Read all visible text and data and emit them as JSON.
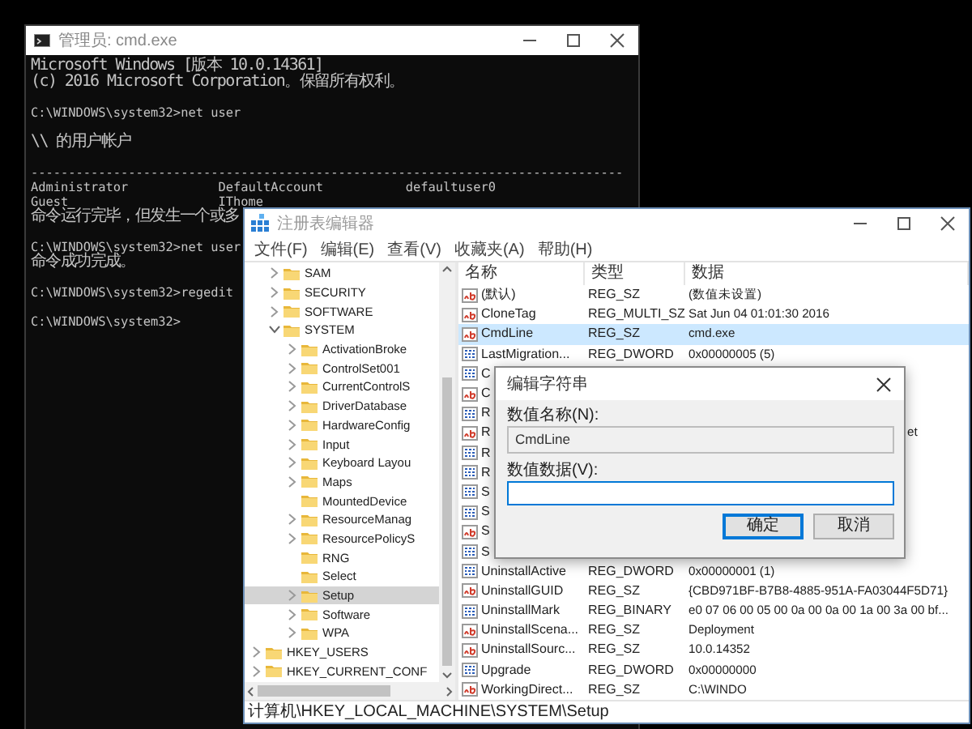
{
  "console_window": {
    "title": "管理员: cmd.exe",
    "blocks": [
      [
        "Microsoft Windows [版本 10.0.14361]",
        "(c) 2016 Microsoft Corporation。保留所有权利。"
      ],
      [
        "C:\\WINDOWS\\system32>net user"
      ],
      [
        "\\\\ 的用户帐户"
      ],
      [
        "-------------------------------------------------------------------------------",
        "Administrator            DefaultAccount           defaultuser0",
        "Guest                    IThome",
        "命令运行完毕，但发生一个或多"
      ],
      [
        "C:\\WINDOWS\\system32>net user",
        "命令成功完成。"
      ],
      [
        "C:\\WINDOWS\\system32>regedit"
      ],
      [
        "C:\\WINDOWS\\system32>"
      ]
    ]
  },
  "regedit_window": {
    "title": "注册表编辑器",
    "menu": [
      "文件(F)",
      "编辑(E)",
      "查看(V)",
      "收藏夹(A)",
      "帮助(H)"
    ],
    "tree": [
      {
        "children": [
          {
            "label": "SAM",
            "kind": "branch",
            "expanded": false,
            "selected": false
          },
          {
            "label": "SECURITY",
            "kind": "branch",
            "expanded": false,
            "selected": false
          },
          {
            "label": "SOFTWARE",
            "kind": "branch",
            "expanded": false,
            "selected": false
          },
          {
            "label": "SYSTEM",
            "kind": "branch",
            "expanded": true,
            "selected": false,
            "children": [
              {
                "label": "ActivationBroke",
                "kind": "branch",
                "expanded": false,
                "selected": false
              },
              {
                "label": "ControlSet001",
                "kind": "branch",
                "expanded": false,
                "selected": false
              },
              {
                "label": "CurrentControlS",
                "kind": "branch",
                "expanded": false,
                "selected": false
              },
              {
                "label": "DriverDatabase",
                "kind": "branch",
                "expanded": false,
                "selected": false
              },
              {
                "label": "HardwareConfig",
                "kind": "branch",
                "expanded": false,
                "selected": false
              },
              {
                "label": "Input",
                "kind": "branch",
                "expanded": false,
                "selected": false
              },
              {
                "label": "Keyboard Layou",
                "kind": "branch",
                "expanded": false,
                "selected": false
              },
              {
                "label": "Maps",
                "kind": "branch",
                "expanded": false,
                "selected": false
              },
              {
                "label": "MountedDevice",
                "kind": "leaf",
                "selected": false
              },
              {
                "label": "ResourceManag",
                "kind": "branch",
                "expanded": false,
                "selected": false
              },
              {
                "label": "ResourcePolicyS",
                "kind": "branch",
                "expanded": false,
                "selected": false
              },
              {
                "label": "RNG",
                "kind": "leaf",
                "selected": false
              },
              {
                "label": "Select",
                "kind": "leaf",
                "selected": false
              },
              {
                "label": "Setup",
                "kind": "branch",
                "expanded": false,
                "selected": true
              },
              {
                "label": "Software",
                "kind": "branch",
                "expanded": false,
                "selected": false
              },
              {
                "label": "WPA",
                "kind": "branch",
                "expanded": false,
                "selected": false
              }
            ]
          }
        ]
      },
      {
        "label": "HKEY_USERS",
        "kind": "branch",
        "expanded": false,
        "selected": false
      },
      {
        "label": "HKEY_CURRENT_CONF",
        "kind": "branch",
        "expanded": false,
        "selected": false
      }
    ],
    "columns": [
      "名称",
      "类型",
      "数据"
    ],
    "rows": [
      {
        "kind": "string",
        "name": "(默认)",
        "type": "REG_SZ",
        "data": "(数值未设置)",
        "selected": false
      },
      {
        "kind": "string",
        "name": "CloneTag",
        "type": "REG_MULTI_SZ",
        "data": "Sat Jun 04 01:01:30 2016",
        "selected": false
      },
      {
        "kind": "string",
        "name": "CmdLine",
        "type": "REG_SZ",
        "data": "cmd.exe",
        "selected": true
      },
      {
        "kind": "binary",
        "name": "LastMigration...",
        "type": "REG_DWORD",
        "data": "0x00000005 (5)",
        "selected": false
      },
      {
        "kind": "binary",
        "name": "C",
        "selected": false
      },
      {
        "kind": "string",
        "name": "C",
        "selected": false
      },
      {
        "kind": "binary",
        "name": "R",
        "selected": false
      },
      {
        "kind": "string",
        "name": "R",
        "data_tail": "et",
        "selected": false
      },
      {
        "kind": "binary",
        "name": "R",
        "selected": false
      },
      {
        "kind": "binary",
        "name": "R",
        "selected": false
      },
      {
        "kind": "binary",
        "name": "S",
        "selected": false
      },
      {
        "kind": "binary",
        "name": "S",
        "selected": false
      },
      {
        "kind": "string",
        "name": "S",
        "selected": false
      },
      {
        "kind": "binary",
        "name": "S",
        "selected": false
      },
      {
        "kind": "binary",
        "name": "UninstallActive",
        "type": "REG_DWORD",
        "data": "0x00000001 (1)",
        "selected": false
      },
      {
        "kind": "string",
        "name": "UninstallGUID",
        "type": "REG_SZ",
        "data": "{CBD971BF-B7B8-4885-951A-FA03044F5D71}",
        "selected": false
      },
      {
        "kind": "binary",
        "name": "UninstallMark",
        "type": "REG_BINARY",
        "data": "e0 07 06 00 05 00 0a 00 0a 00 1a 00 3a 00 bf...",
        "selected": false
      },
      {
        "kind": "string",
        "name": "UninstallScena...",
        "type": "REG_SZ",
        "data": "Deployment",
        "selected": false
      },
      {
        "kind": "string",
        "name": "UninstallSourc...",
        "type": "REG_SZ",
        "data": "10.0.14352",
        "selected": false
      },
      {
        "kind": "binary",
        "name": "Upgrade",
        "type": "REG_DWORD",
        "data": "0x00000000",
        "selected": false
      },
      {
        "kind": "string",
        "name": "WorkingDirect...",
        "type": "REG_SZ",
        "data": "C:\\WINDO",
        "selected": false
      }
    ],
    "status_bar": "计算机\\HKEY_LOCAL_MACHINE\\SYSTEM\\Setup"
  },
  "edit_dialog": {
    "title": "编辑字符串",
    "name_label": "数值名称(N):",
    "name_value": "CmdLine",
    "data_label": "数值数据(V):",
    "buttons": [
      {
        "label": "确定",
        "default": true
      },
      {
        "label": "取消",
        "default": false
      }
    ]
  }
}
